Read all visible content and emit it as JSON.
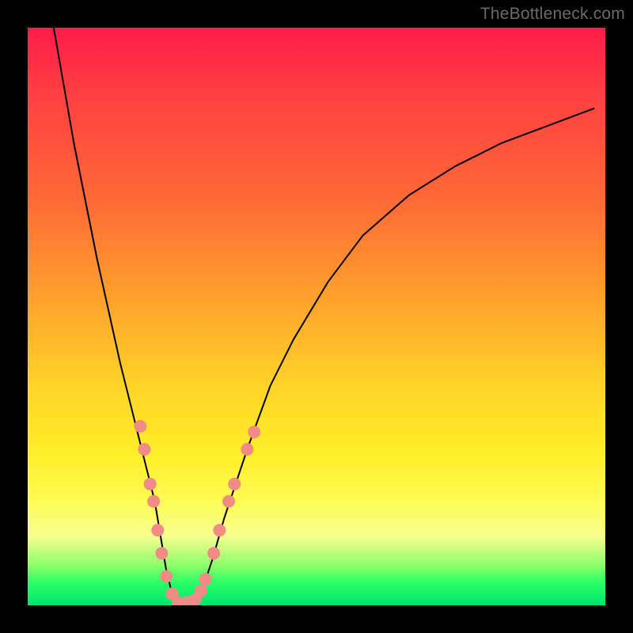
{
  "watermark": "TheBottleneck.com",
  "chart_data": {
    "type": "line",
    "title": "",
    "xlabel": "",
    "ylabel": "",
    "xlim": [
      0,
      100
    ],
    "ylim": [
      0,
      100
    ],
    "grid": false,
    "series": [
      {
        "name": "curve",
        "color": "#000000",
        "x": [
          4.5,
          8,
          12,
          16,
          18,
          20,
          21,
          22,
          23,
          24,
          25,
          26,
          28,
          30,
          32,
          34,
          38,
          42,
          46,
          52,
          58,
          66,
          74,
          82,
          90,
          98
        ],
        "y": [
          100,
          80,
          60,
          42,
          34,
          26,
          22,
          18,
          12,
          6,
          2,
          0,
          0,
          2,
          8,
          15,
          27,
          38,
          46,
          56,
          64,
          71,
          76,
          80,
          83,
          86
        ]
      }
    ],
    "markers": {
      "name": "dots",
      "color": "#f08b86",
      "radius_px": 8,
      "points": [
        {
          "x": 19.5,
          "y": 31
        },
        {
          "x": 20.2,
          "y": 27
        },
        {
          "x": 21.2,
          "y": 21
        },
        {
          "x": 21.8,
          "y": 18
        },
        {
          "x": 22.5,
          "y": 13
        },
        {
          "x": 23.2,
          "y": 9
        },
        {
          "x": 24.0,
          "y": 5
        },
        {
          "x": 25.0,
          "y": 2
        },
        {
          "x": 26.0,
          "y": 0.5
        },
        {
          "x": 27.5,
          "y": 0.5
        },
        {
          "x": 29.0,
          "y": 1
        },
        {
          "x": 30.0,
          "y": 2.5
        },
        {
          "x": 30.8,
          "y": 4.5
        },
        {
          "x": 32.2,
          "y": 9
        },
        {
          "x": 33.2,
          "y": 13
        },
        {
          "x": 34.8,
          "y": 18
        },
        {
          "x": 35.8,
          "y": 21
        },
        {
          "x": 38.0,
          "y": 27
        },
        {
          "x": 39.2,
          "y": 30
        }
      ]
    }
  }
}
